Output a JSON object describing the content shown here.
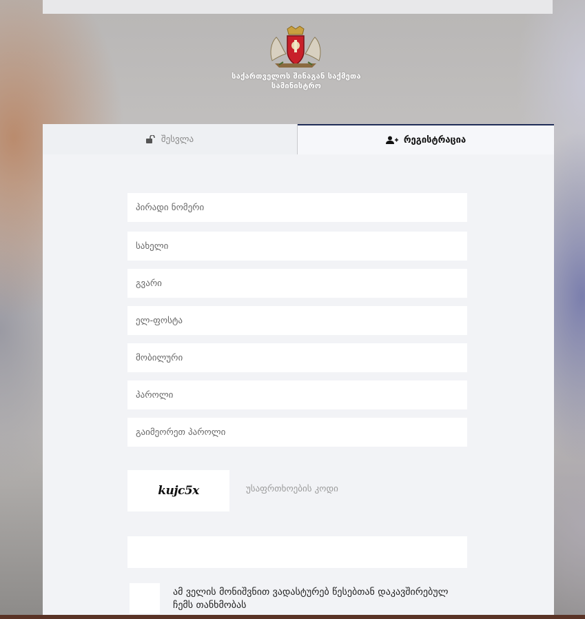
{
  "header": {
    "org_name": "საქართველოს შინაგან საქმეთა სამინისტრო"
  },
  "tabs": {
    "login_label": "შესვლა",
    "register_label": "რეგისტრაცია"
  },
  "form": {
    "personal_number_placeholder": "პირადი ნომერი",
    "first_name_placeholder": "სახელი",
    "last_name_placeholder": "გვარი",
    "email_placeholder": "ელ-ფოსტა",
    "mobile_placeholder": "მობილური",
    "password_placeholder": "პაროლი",
    "repeat_password_placeholder": "გაიმეორეთ პაროლი",
    "captcha_text": "kujc5x",
    "captcha_label": "უსაფრთხოების კოდი",
    "terms_text": "ამ ველის მონიშვნით ვადასტურებ წესებთან დაკავშირებულ ჩემს თანხმობას"
  }
}
